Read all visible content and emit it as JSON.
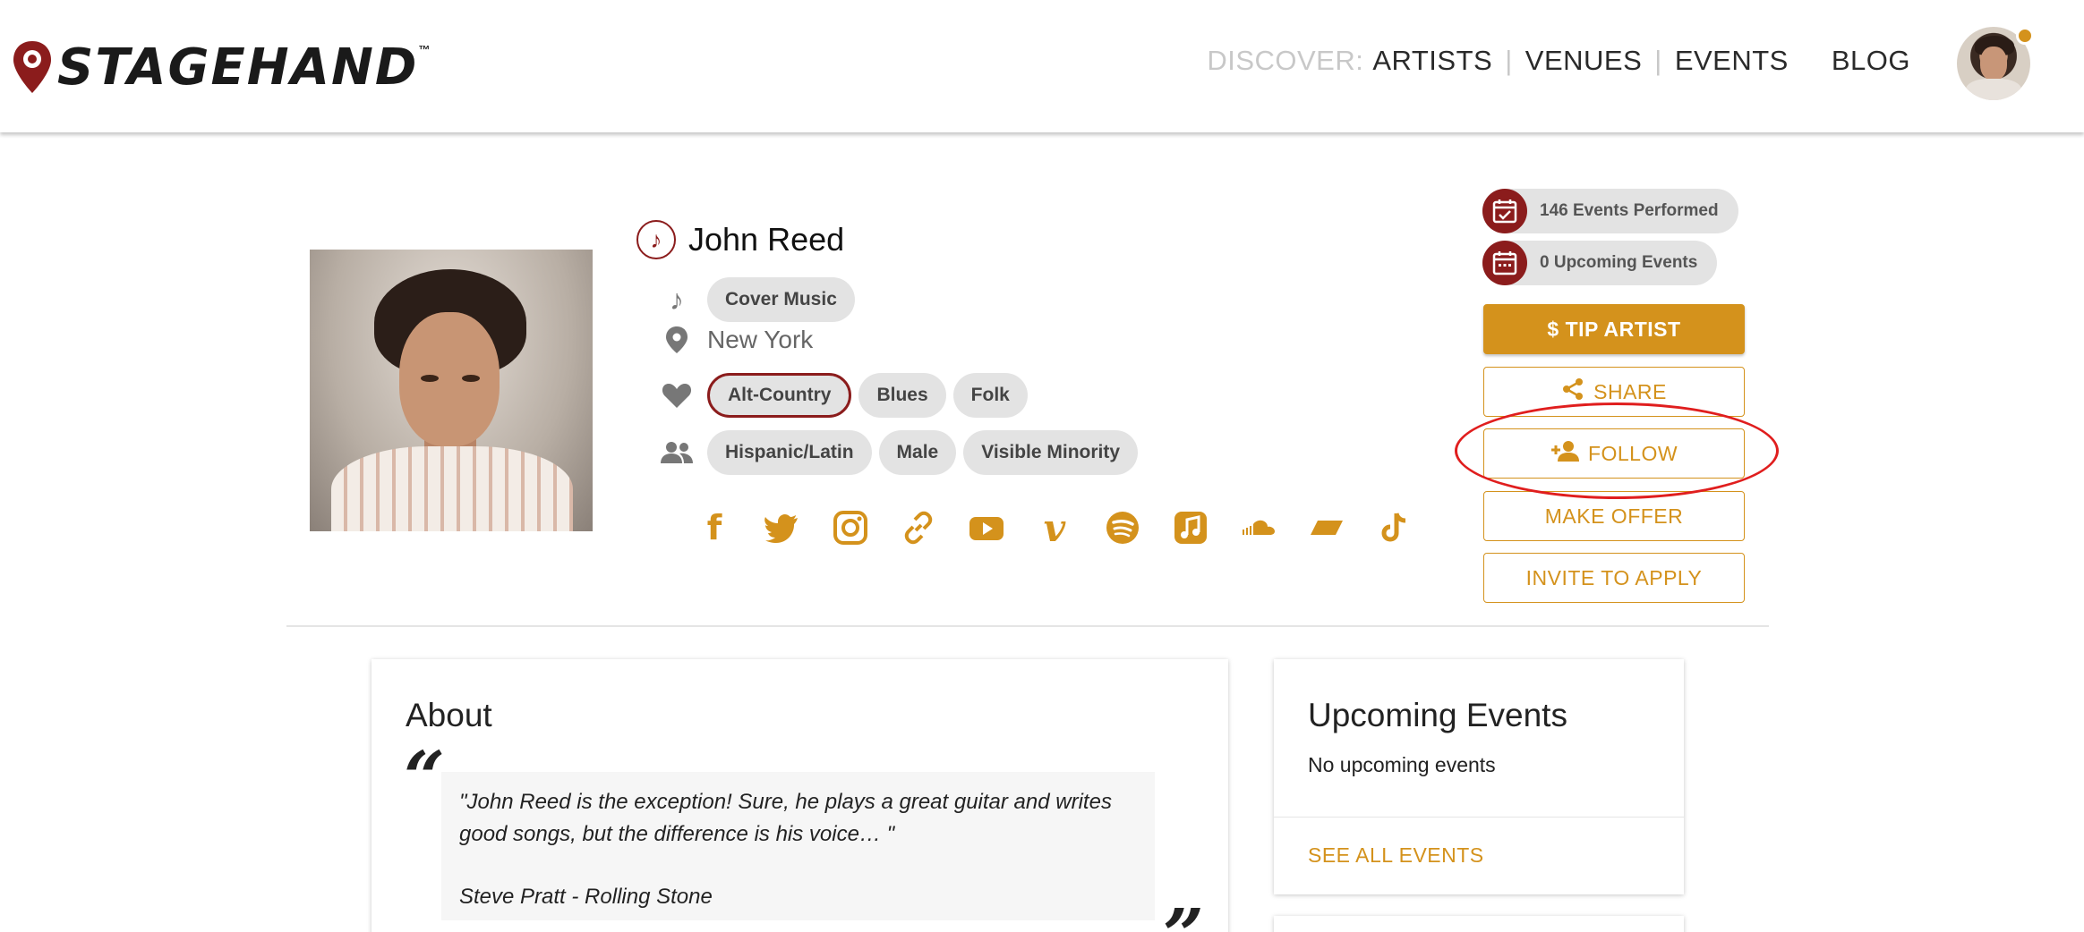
{
  "brand": {
    "name": "STAGEHAND",
    "tm": "™"
  },
  "nav": {
    "discover_label": "DISCOVER:",
    "artists": "ARTISTS",
    "sep1": "|",
    "venues": "VENUES",
    "sep2": "|",
    "events": "EVENTS",
    "blog": "BLOG"
  },
  "artist": {
    "name": "John Reed",
    "category": "Cover Music",
    "location": "New York",
    "genres": [
      "Alt-Country",
      "Blues",
      "Folk"
    ],
    "active_genre": "Alt-Country",
    "identities": [
      "Hispanic/Latin",
      "Male",
      "Visible Minority"
    ]
  },
  "socials": [
    "facebook-icon",
    "twitter-icon",
    "instagram-icon",
    "link-icon",
    "youtube-icon",
    "vimeo-icon",
    "spotify-icon",
    "apple-music-icon",
    "soundcloud-icon",
    "bandcamp-icon",
    "tiktok-icon"
  ],
  "stats": {
    "performed": "146 Events Performed",
    "upcoming": "0 Upcoming Events"
  },
  "actions": {
    "tip": "$ TIP ARTIST",
    "share": "SHARE",
    "follow": "FOLLOW",
    "offer": "MAKE OFFER",
    "invite": "INVITE TO APPLY"
  },
  "about": {
    "title": "About",
    "quote_open": "“",
    "quote_close": "”",
    "quote": "\"John Reed is the exception! Sure, he plays a great guitar and writes good songs, but the difference is his voice… \"",
    "author": "Steve Pratt - Rolling Stone"
  },
  "upcoming": {
    "title": "Upcoming Events",
    "empty": "No upcoming events",
    "see_all": "SEE ALL EVENTS"
  },
  "colors": {
    "accent": "#d4921c",
    "brand_red": "#8b1c1c",
    "annotation": "#e01e1e",
    "chip_bg": "#e3e3e3"
  }
}
